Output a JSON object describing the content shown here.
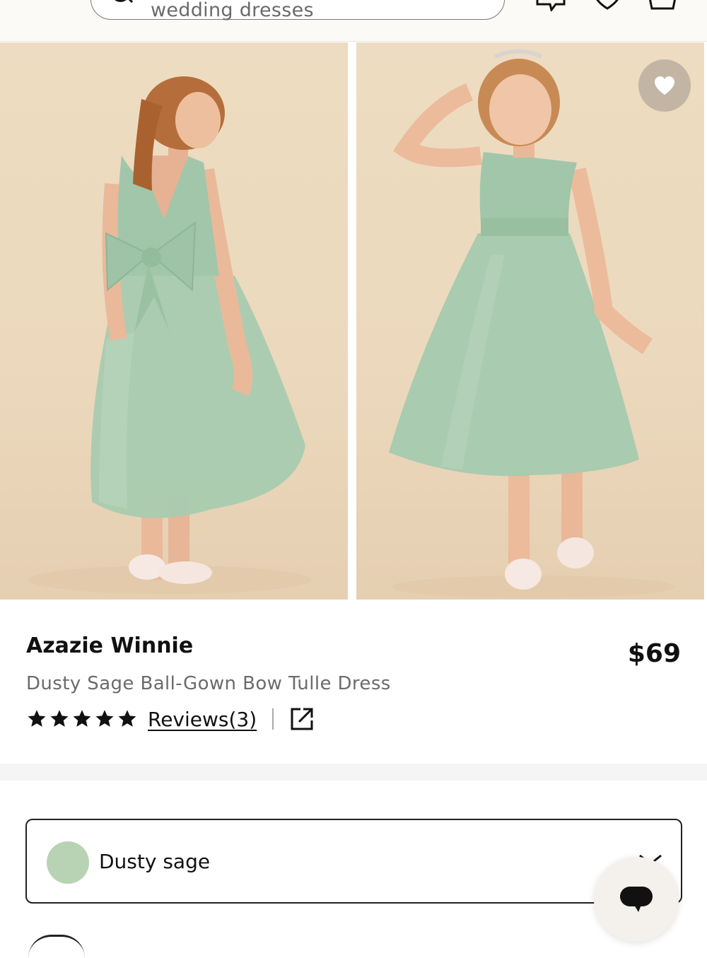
{
  "header": {
    "search_text": "wedding dresses",
    "icons": [
      "menu-icon",
      "search-icon",
      "chat-icon",
      "heart-icon",
      "bag-icon"
    ]
  },
  "product": {
    "brand": "Azazie Winnie",
    "title": "Dusty Sage Ball-Gown Bow Tulle Dress",
    "price": "$69",
    "rating_stars": 5,
    "reviews_label": "Reviews(3)",
    "selected_color": "Dusty sage",
    "swatch_color": "#b7d3b3"
  },
  "colors": {
    "accent": "#111111",
    "dress": "#a9cbb0",
    "backdrop": "#ecd9bd"
  }
}
